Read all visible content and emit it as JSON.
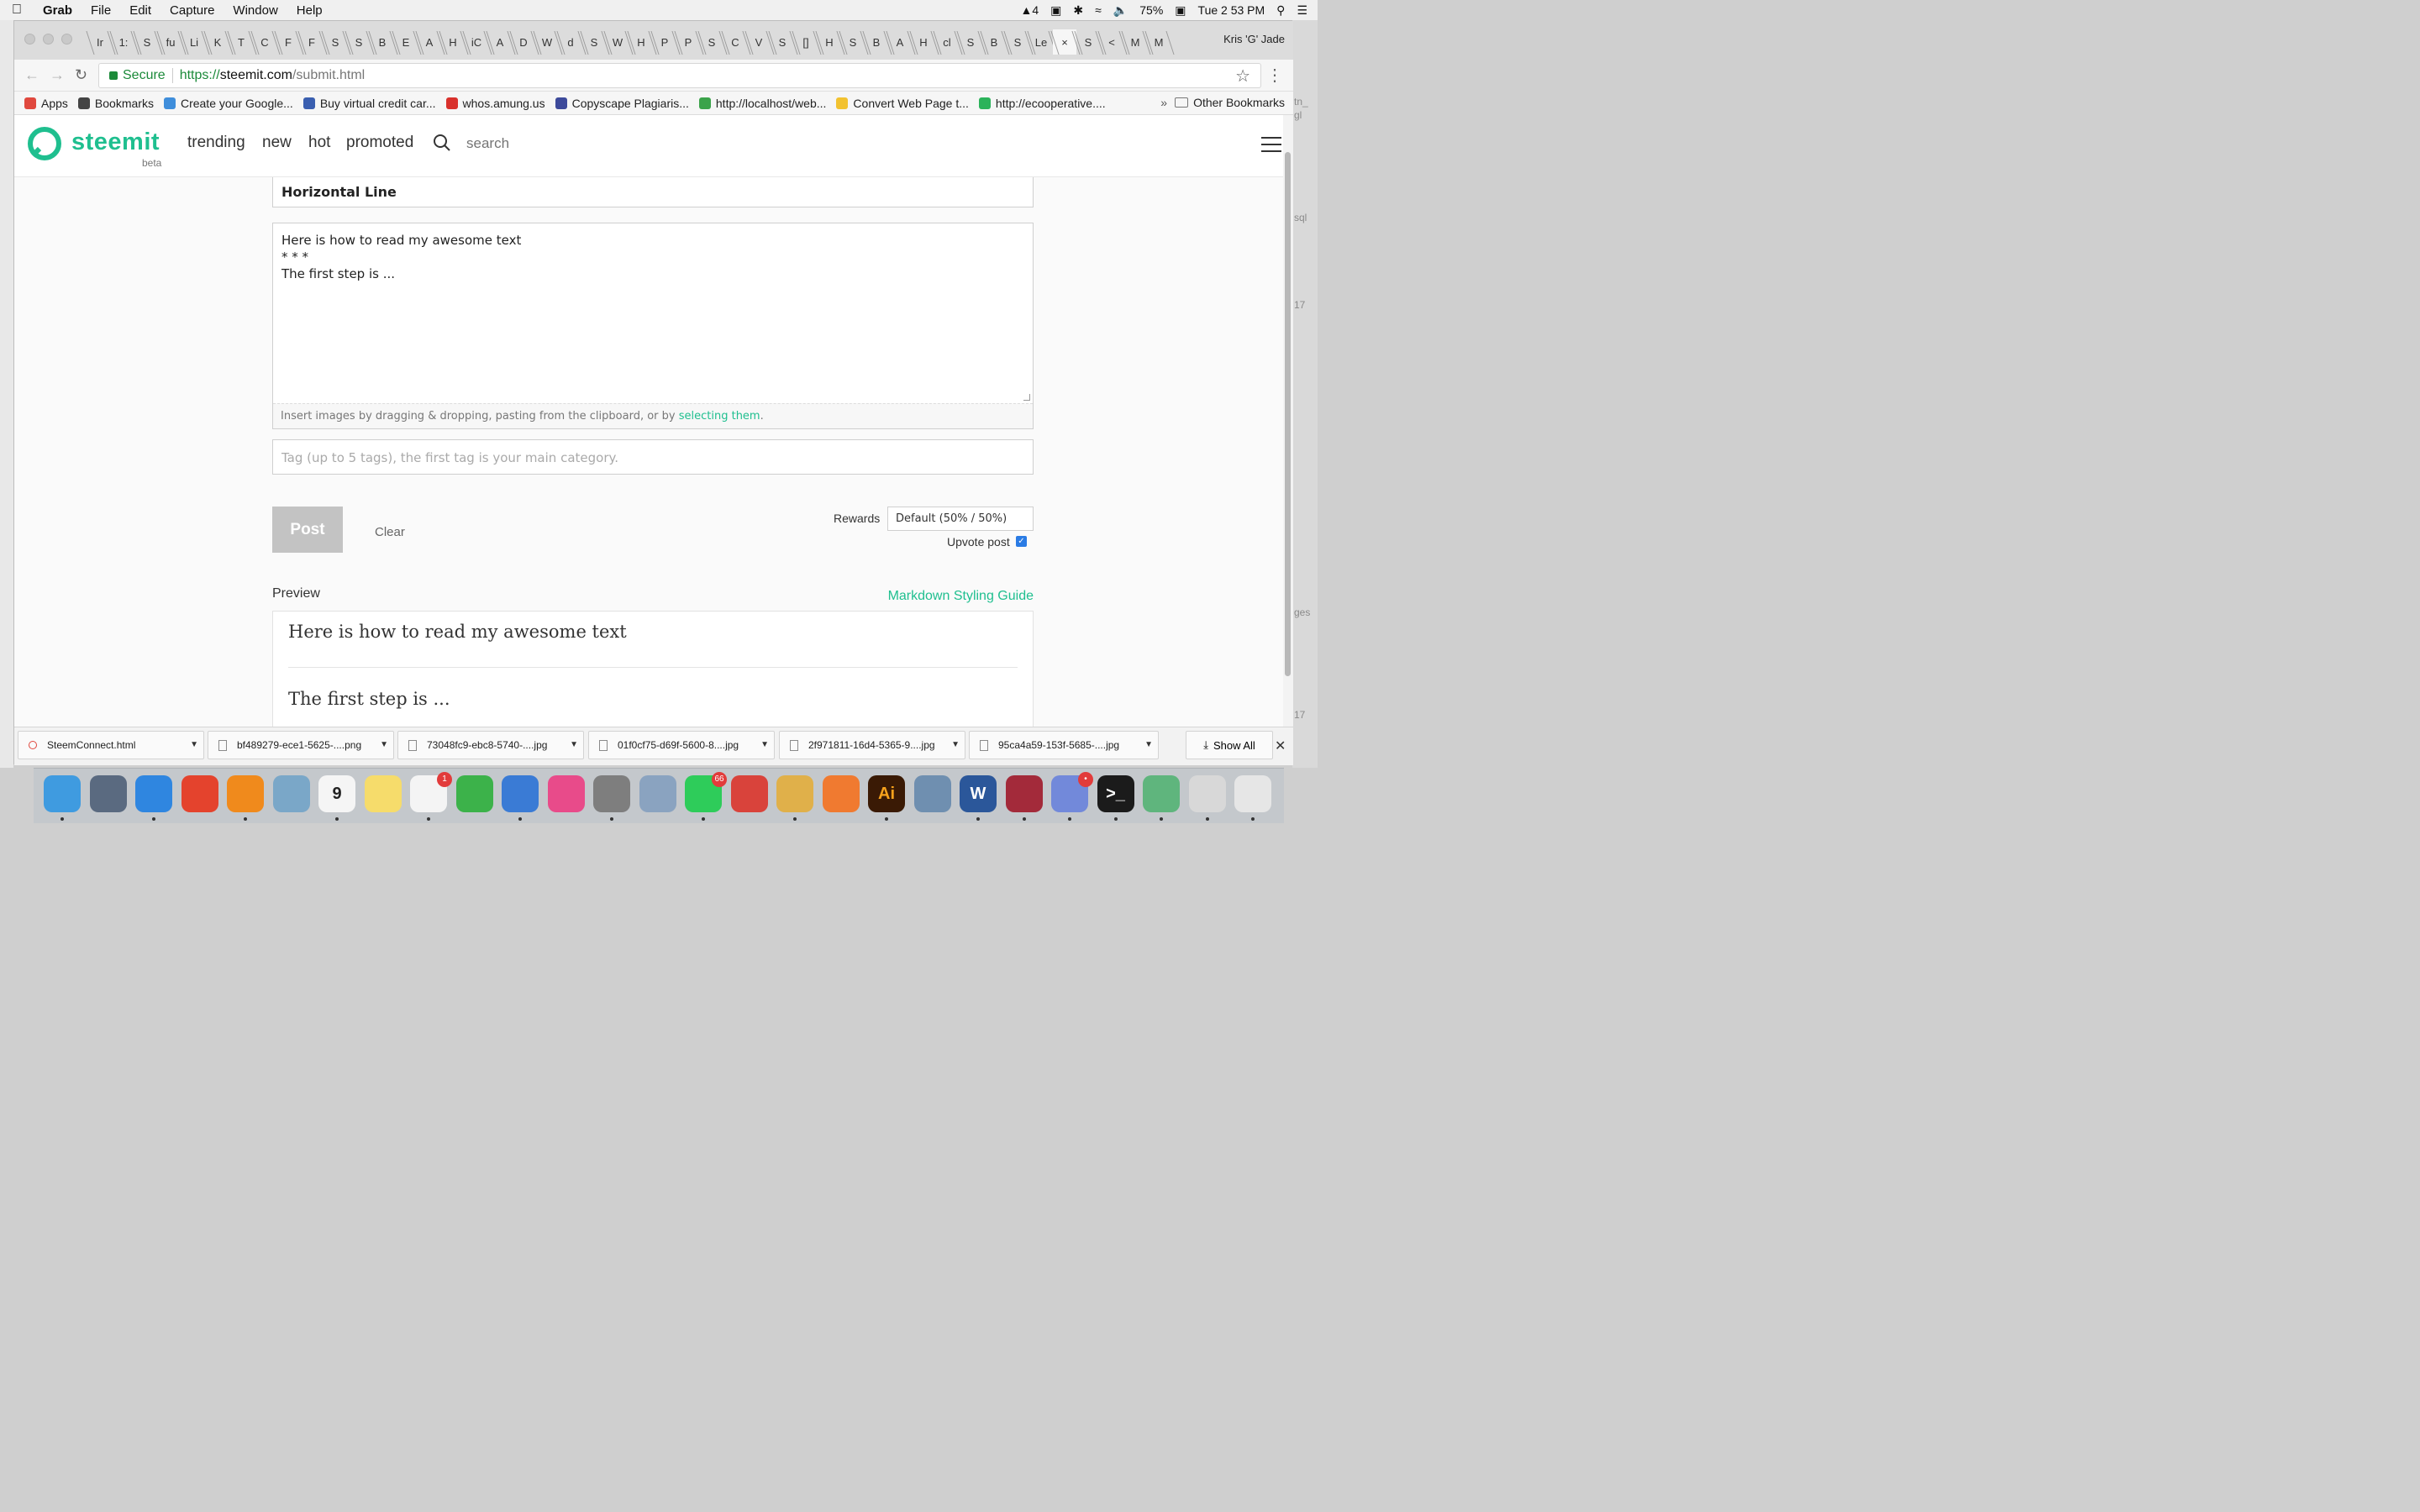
{
  "menubar": {
    "app": "Grab",
    "items": [
      "File",
      "Edit",
      "Capture",
      "Window",
      "Help"
    ],
    "status": {
      "adobe_count": "4",
      "battery": "75%",
      "clock": "Tue 2 53 PM"
    }
  },
  "desktop_labels": [
    "tn_",
    "gl",
    "sql",
    "17",
    "ges",
    "17"
  ],
  "browser": {
    "tabs": [
      "Ir",
      "1:",
      "S",
      "fu",
      "Li",
      "K",
      "T",
      "C",
      "F",
      "F",
      "S",
      "S",
      "B",
      "E",
      "A",
      "H",
      "iC",
      "A",
      "D",
      "W",
      "d",
      "S",
      "W",
      "H",
      "P",
      "P",
      "S",
      "C",
      "V",
      "S",
      "[]",
      "H",
      "S",
      "B",
      "A",
      "H",
      "cl",
      "S",
      "B",
      "S",
      "Le",
      "×",
      "S",
      "<",
      "M",
      "M"
    ],
    "profile": "Kris 'G' Jade",
    "omnibox": {
      "secure": "Secure",
      "scheme": "https://",
      "host": "steemit.com",
      "path": "/submit.html"
    },
    "bookmarks": [
      {
        "label": "Apps",
        "color": "#e0483e"
      },
      {
        "label": "Bookmarks",
        "color": "#444444"
      },
      {
        "label": "Create your Google...",
        "color": "#3f8edb"
      },
      {
        "label": "Buy virtual credit car...",
        "color": "#3a5fb0"
      },
      {
        "label": "whos.amung.us",
        "color": "#d9312c"
      },
      {
        "label": "Copyscape Plagiaris...",
        "color": "#3d4a9b"
      },
      {
        "label": "http://localhost/web...",
        "color": "#3ba34a"
      },
      {
        "label": "Convert Web Page t...",
        "color": "#f2c230"
      },
      {
        "label": "http://ecooperative....",
        "color": "#2bb35a"
      }
    ],
    "bookmarks_more": "»",
    "other_bookmarks": "Other Bookmarks"
  },
  "site": {
    "logo": "steemit",
    "beta": "beta",
    "nav": [
      "trending",
      "new",
      "hot",
      "promoted"
    ],
    "search_placeholder": "search"
  },
  "editor": {
    "title": "Horizontal Line",
    "body": "Here is how to read my awesome text\n* * *\nThe first step is ...",
    "upload_hint": "Insert images by dragging & dropping, pasting from the clipboard, or by",
    "upload_link": "selecting them",
    "tag_placeholder": "Tag (up to 5 tags), the first tag is your main category.",
    "post": "Post",
    "clear": "Clear",
    "rewards_label": "Rewards",
    "rewards_value": "Default (50% / 50%)",
    "upvote_label": "Upvote post",
    "upvote_checked": true
  },
  "preview": {
    "label": "Preview",
    "guide_link": "Markdown Styling Guide",
    "paragraph1": "Here is how to read my awesome text",
    "paragraph2": "The first step is ..."
  },
  "downloads": {
    "items": [
      "SteemConnect.html",
      "bf489279-ece1-5625-....png",
      "73048fc9-ebc8-5740-....jpg",
      "01f0cf75-d69f-5600-8....jpg",
      "2f971811-16d4-5365-9....jpg",
      "95ca4a59-153f-5685-....jpg"
    ],
    "show_all": "Show All"
  },
  "dock": {
    "apps": [
      {
        "name": "finder",
        "color": "#3f9be0"
      },
      {
        "name": "launchpad",
        "color": "#5a6a80"
      },
      {
        "name": "safari",
        "color": "#2f86e0"
      },
      {
        "name": "chrome",
        "color": "#e4432d"
      },
      {
        "name": "vlc",
        "color": "#f08a1c"
      },
      {
        "name": "preview",
        "color": "#7aa7c8"
      },
      {
        "name": "calendar",
        "color": "#f5f5f5",
        "label": "9"
      },
      {
        "name": "notes",
        "color": "#f6dc6b"
      },
      {
        "name": "reminders",
        "color": "#f4f4f4",
        "badge": "1"
      },
      {
        "name": "numbers",
        "color": "#3cb24a"
      },
      {
        "name": "keynote",
        "color": "#3a7bd5"
      },
      {
        "name": "itunes",
        "color": "#e84b8a"
      },
      {
        "name": "system-preferences",
        "color": "#7e7e7e"
      },
      {
        "name": "gear-app",
        "color": "#8aa3c0"
      },
      {
        "name": "whatsapp",
        "color": "#2ecc5a",
        "badge": "66"
      },
      {
        "name": "wunderlist",
        "color": "#d9433b"
      },
      {
        "name": "sequel-pro",
        "color": "#e0b04a"
      },
      {
        "name": "paw",
        "color": "#f07a30"
      },
      {
        "name": "illustrator",
        "color": "#3a1a05",
        "label": "Ai"
      },
      {
        "name": "image-capture",
        "color": "#6f8fb0"
      },
      {
        "name": "word",
        "color": "#2b579a",
        "label": "W"
      },
      {
        "name": "wine",
        "color": "#a32a3a"
      },
      {
        "name": "discord",
        "color": "#7289da",
        "badge": "•"
      },
      {
        "name": "terminal",
        "color": "#1b1b1b",
        "label": ">_"
      },
      {
        "name": "atom",
        "color": "#5fb57d"
      },
      {
        "name": "scissors-app",
        "color": "#d8d8d8"
      },
      {
        "name": "trash",
        "color": "#e6e6e6"
      }
    ]
  }
}
